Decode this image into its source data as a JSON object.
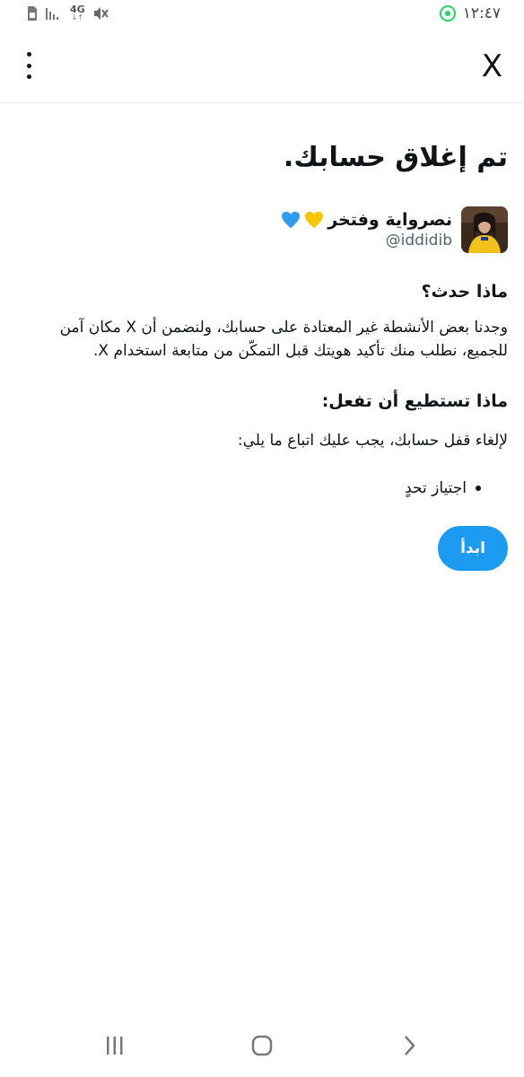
{
  "status_bar": {
    "time": "١٢:٤٧",
    "network": "4G",
    "icons": [
      "whatsapp-icon",
      "sim-icon",
      "signal-icon",
      "network-4g-icon",
      "mute-icon"
    ]
  },
  "header": {
    "logo": "X",
    "menu_icon": "more-vertical-icon"
  },
  "page": {
    "title": "تم إغلاق حسابك.",
    "account": {
      "name": "نصرواية وفتخر",
      "handle": "@iddidib"
    },
    "what_happened": {
      "heading": "ماذا حدث؟",
      "body": "وجدنا بعض الأنشطة غير المعتادة على حسابك، ولنضمن أن X مكان آمن للجميع، نطلب منك تأكيد هويتك قبل التمكّن من متابعة استخدام X."
    },
    "what_to_do": {
      "heading": "ماذا تستطيع أن تفعل:",
      "body": "لإلغاء قفل حسابك، يجب عليك اتباع ما يلي:",
      "steps": [
        "اجتياز تحدٍ"
      ]
    },
    "start_button": "ابدأ"
  },
  "nav_bar": {
    "recent_icon": "recent-apps-icon",
    "home_icon": "home-icon",
    "back_icon": "back-icon"
  },
  "colors": {
    "accent": "#1d9bf0",
    "text": "#0f1419",
    "muted": "#536471",
    "heart_yellow": "#f7c600",
    "heart_blue": "#2f9cf0"
  }
}
